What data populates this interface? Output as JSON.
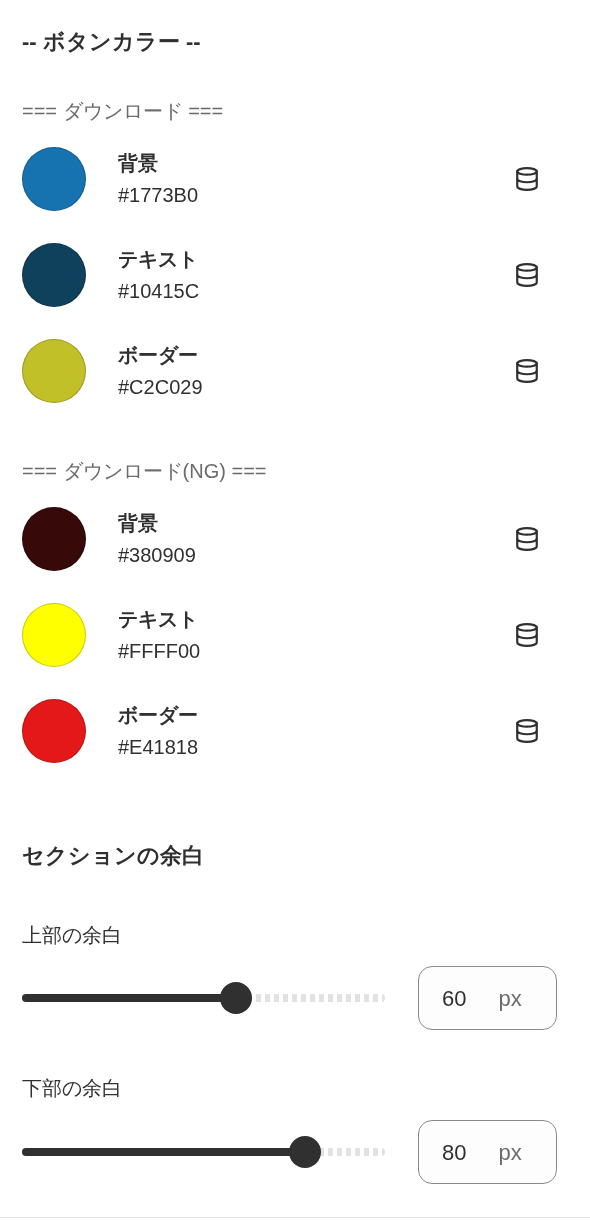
{
  "title": "-- ボタンカラー --",
  "groups": [
    {
      "label": "=== ダウンロード ===",
      "colors": [
        {
          "label": "背景",
          "value": "#1773B0",
          "color": "#1773b0"
        },
        {
          "label": "テキスト",
          "value": "#10415C",
          "color": "#10415c"
        },
        {
          "label": "ボーダー",
          "value": "#C2C029",
          "color": "#c2c029"
        }
      ]
    },
    {
      "label": "=== ダウンロード(NG) ===",
      "colors": [
        {
          "label": "背景",
          "value": "#380909",
          "color": "#380909"
        },
        {
          "label": "テキスト",
          "value": "#FFFF00",
          "color": "#ffff00"
        },
        {
          "label": "ボーダー",
          "value": "#E41818",
          "color": "#e41818"
        }
      ]
    }
  ],
  "section": {
    "title": "セクションの余白",
    "sliders": [
      {
        "label": "上部の余白",
        "value": "60",
        "unit": "px",
        "level": 0.59
      },
      {
        "label": "下部の余白",
        "value": "80",
        "unit": "px",
        "level": 0.78
      }
    ]
  }
}
